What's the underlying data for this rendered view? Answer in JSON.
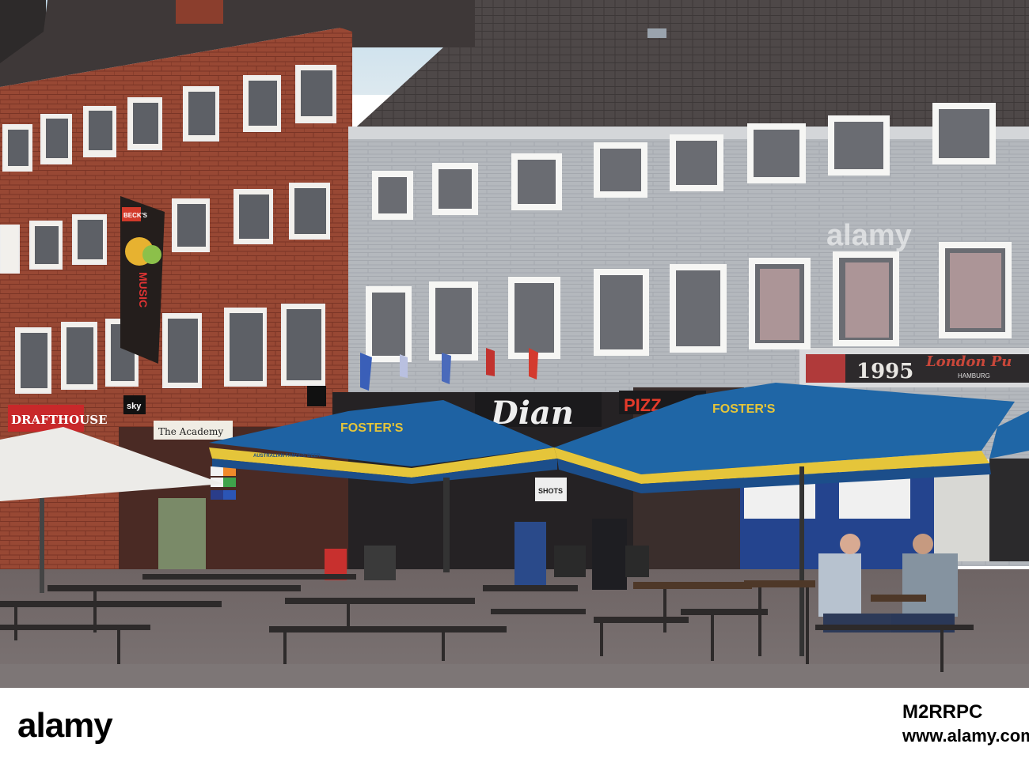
{
  "image": {
    "description_colors": {
      "sky": "#cfe3ef",
      "brick": "#9a4a35",
      "stucco": "#b9bdc2",
      "umbrella_blue": "#1f66a6",
      "umbrella_yellow": "#e5c73a",
      "cobble": "#6f6a6a"
    }
  },
  "signs": {
    "drafthouse": "DRAFTHOUSE",
    "becks": "BECK'S",
    "music": "MUSIC",
    "sky": "sky",
    "academy": "The Academy",
    "fosters": "FOSTER'S",
    "australian": "AUSTRALIAN FAMOUS BEER",
    "pub_year": "1995",
    "london_pub": "London Pu",
    "hamburg": "HAMBURG",
    "dian": "Dian",
    "shots": "SHOTS",
    "pizza": "PIZZ"
  },
  "watermark": {
    "text": "alamy"
  },
  "footer": {
    "logo": "alamy",
    "image_id": "M2RRPC",
    "url": "www.alamy.com"
  }
}
